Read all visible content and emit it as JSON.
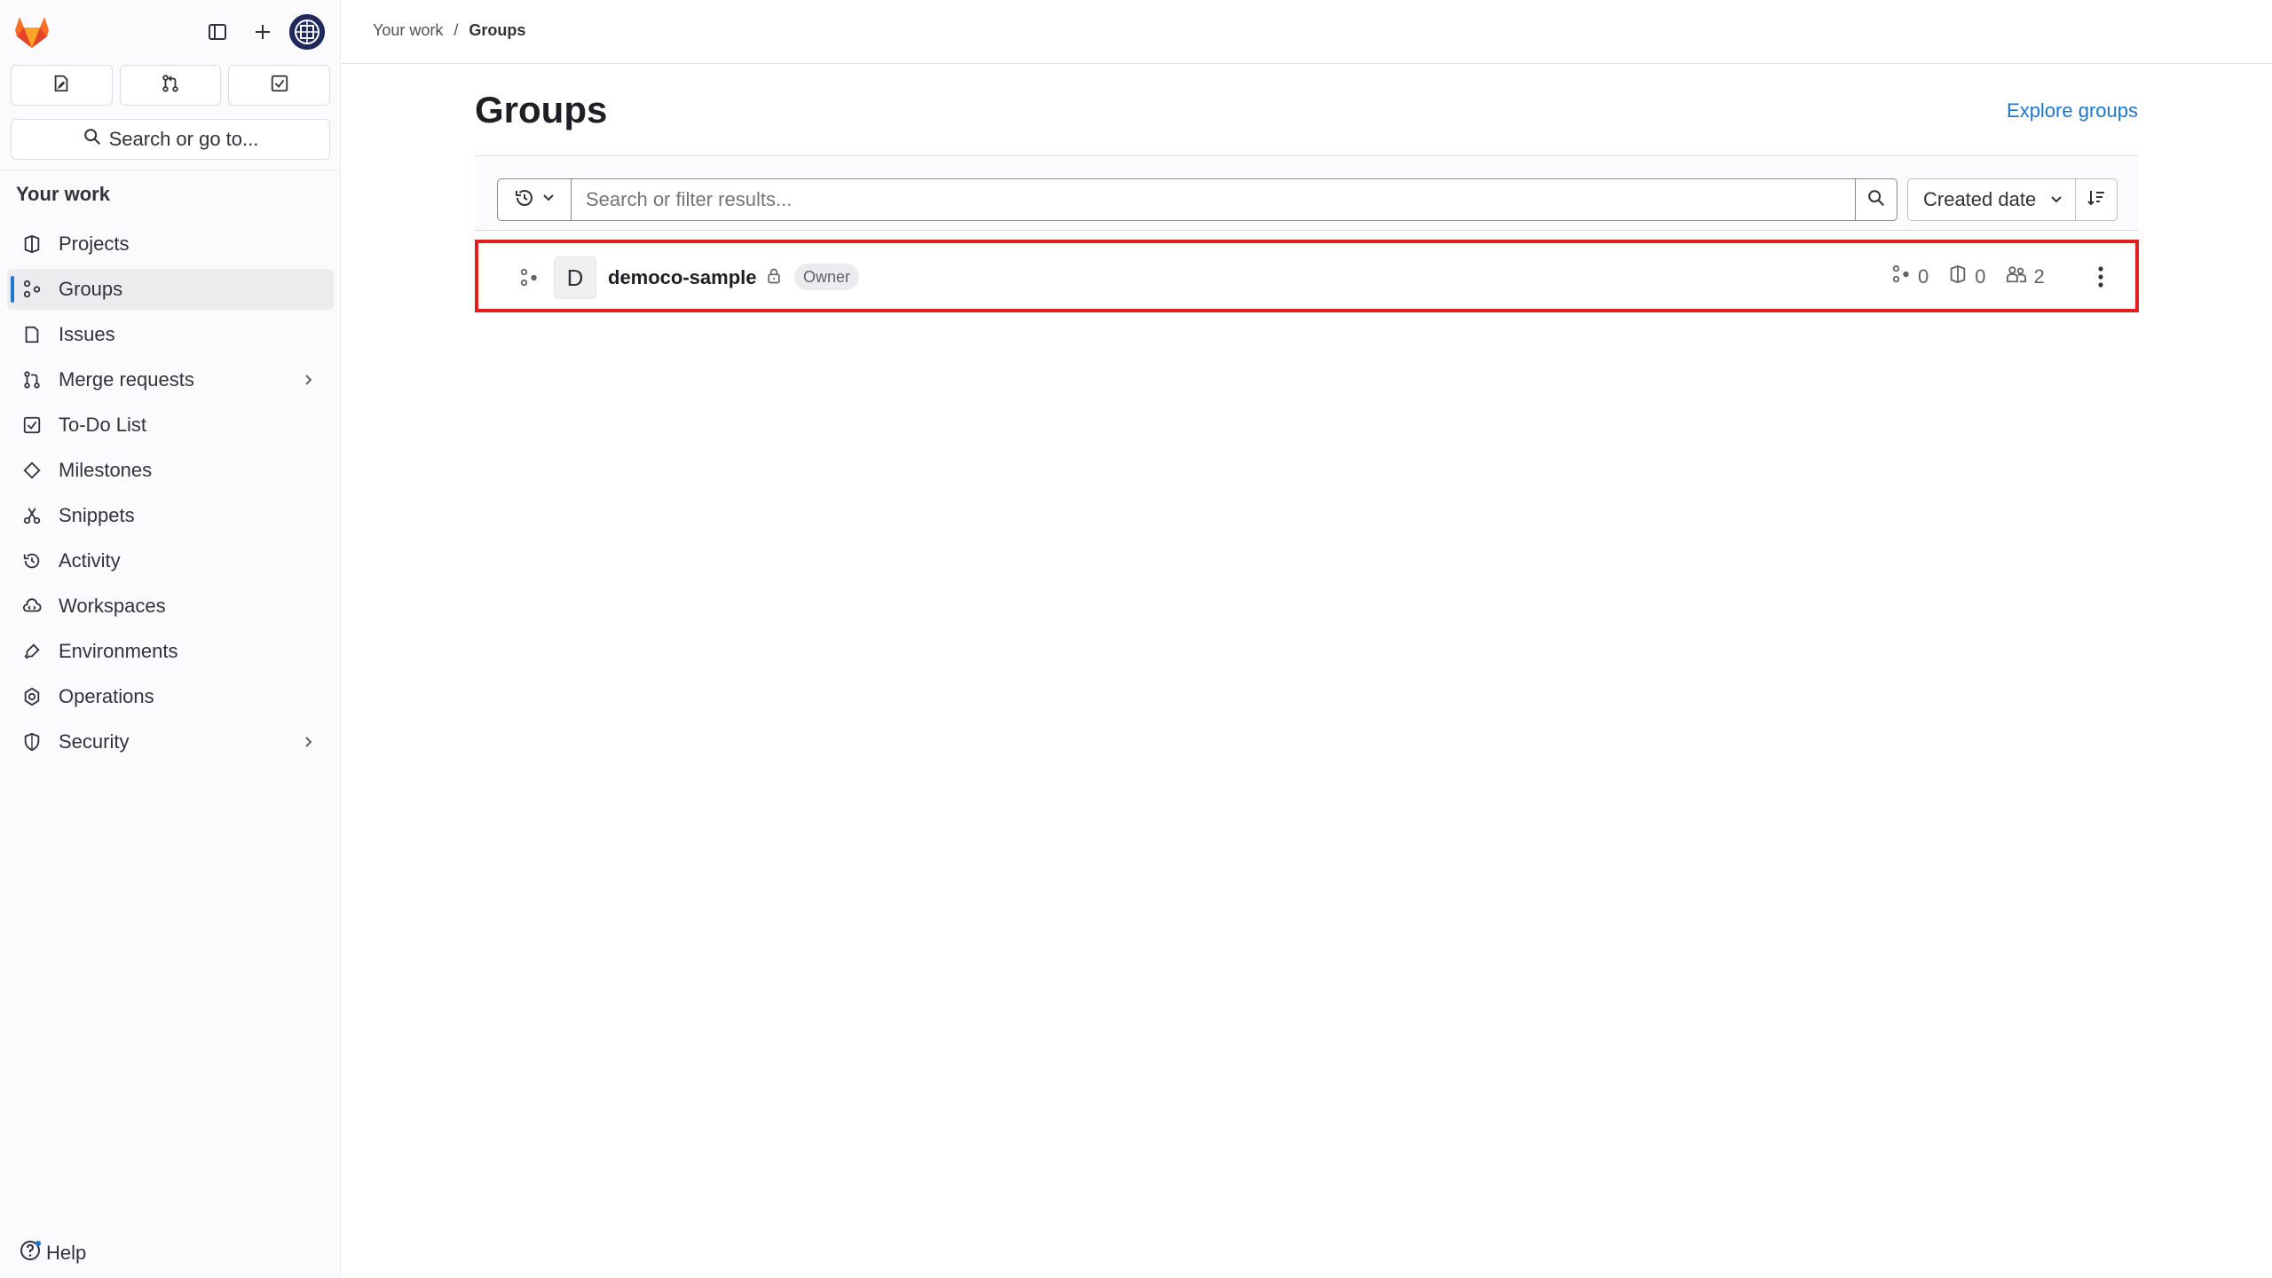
{
  "sidebar": {
    "search_label": "Search or go to...",
    "section_title": "Your work",
    "items": [
      {
        "label": "Projects"
      },
      {
        "label": "Groups"
      },
      {
        "label": "Issues"
      },
      {
        "label": "Merge requests"
      },
      {
        "label": "To-Do List"
      },
      {
        "label": "Milestones"
      },
      {
        "label": "Snippets"
      },
      {
        "label": "Activity"
      },
      {
        "label": "Workspaces"
      },
      {
        "label": "Environments"
      },
      {
        "label": "Operations"
      },
      {
        "label": "Security"
      }
    ],
    "help_label": "Help"
  },
  "breadcrumb": {
    "parent": "Your work",
    "separator": "/",
    "current": "Groups"
  },
  "page": {
    "title": "Groups",
    "explore_link": "Explore groups"
  },
  "filter": {
    "placeholder": "Search or filter results...",
    "sort_label": "Created date"
  },
  "groups": [
    {
      "avatar_letter": "D",
      "name": "democo-sample",
      "role": "Owner",
      "subgroups": "0",
      "projects": "0",
      "members": "2"
    }
  ],
  "colors": {
    "accent": "#1f75cb",
    "highlight_border": "#e41d1d",
    "logo_orange": "#fc6d26"
  }
}
